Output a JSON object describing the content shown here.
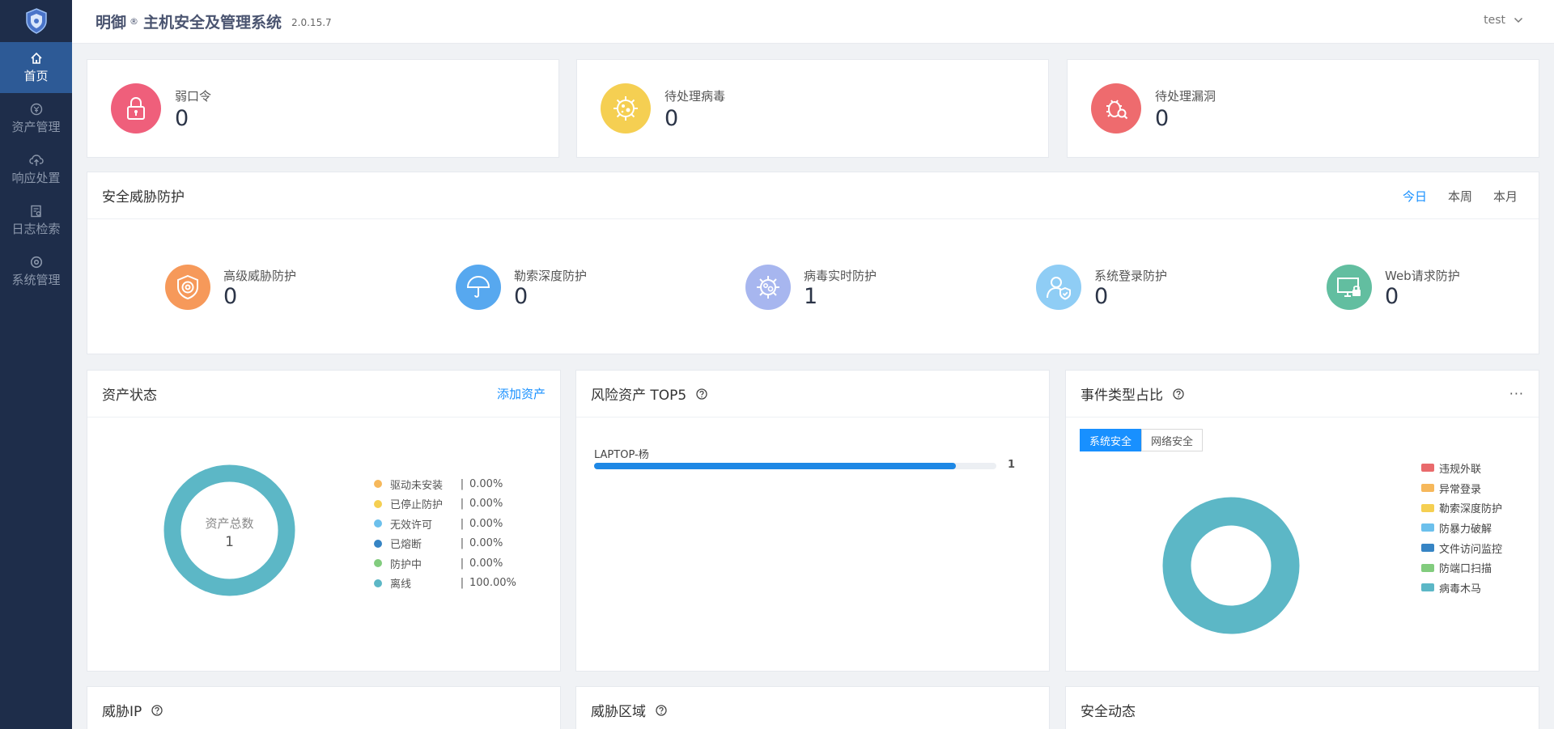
{
  "sidebar": {
    "items": [
      {
        "label": "首页",
        "icon": "home-icon",
        "active": true
      },
      {
        "label": "资产管理",
        "icon": "asset-icon"
      },
      {
        "label": "响应处置",
        "icon": "cloud-upload-icon"
      },
      {
        "label": "日志检索",
        "icon": "log-search-icon"
      },
      {
        "label": "系统管理",
        "icon": "settings-icon"
      }
    ]
  },
  "header": {
    "brand": "明御",
    "reg": "®",
    "title": "主机安全及管理系统",
    "version": "2.0.15.7",
    "user": "test"
  },
  "stats": [
    {
      "label": "弱口令",
      "value": "0",
      "icon": "lock-icon",
      "color": "#ef5f7b"
    },
    {
      "label": "待处理病毒",
      "value": "0",
      "icon": "virus-icon",
      "color": "#f5cf52"
    },
    {
      "label": "待处理漏洞",
      "value": "0",
      "icon": "bug-icon",
      "color": "#ee6b6e"
    }
  ],
  "threat_panel": {
    "title": "安全威胁防护",
    "ranges": [
      "今日",
      "本周",
      "本月"
    ],
    "active_range": "今日",
    "items": [
      {
        "label": "高级威胁防护",
        "value": "0",
        "icon": "shield-target-icon",
        "color": "#f6995a"
      },
      {
        "label": "勒索深度防护",
        "value": "0",
        "icon": "umbrella-icon",
        "color": "#57a8ef"
      },
      {
        "label": "病毒实时防护",
        "value": "1",
        "icon": "virus-scan-icon",
        "color": "#a7b6ef"
      },
      {
        "label": "系统登录防护",
        "value": "0",
        "icon": "user-shield-icon",
        "color": "#8fcdf5"
      },
      {
        "label": "Web请求防护",
        "value": "0",
        "icon": "monitor-lock-icon",
        "color": "#62bea0"
      }
    ]
  },
  "asset_panel": {
    "title": "资产状态",
    "link": "添加资产",
    "center_label": "资产总数",
    "center_value": "1",
    "legend": [
      {
        "name": "驱动未安装",
        "pct": "0.00%",
        "color": "#f6b85b"
      },
      {
        "name": "已停止防护",
        "pct": "0.00%",
        "color": "#f5cf52"
      },
      {
        "name": "无效许可",
        "pct": "0.00%",
        "color": "#6cc0ec"
      },
      {
        "name": "已熔断",
        "pct": "0.00%",
        "color": "#3684c4"
      },
      {
        "name": "防护中",
        "pct": "0.00%",
        "color": "#82cc7e"
      },
      {
        "name": "离线",
        "pct": "100.00%",
        "color": "#5cb7c6"
      }
    ]
  },
  "top5_panel": {
    "title": "风险资产 TOP5",
    "rows": [
      {
        "name": "LAPTOP-杨",
        "value": "1",
        "fraction": 0.9
      }
    ]
  },
  "event_panel": {
    "title": "事件类型占比",
    "more": "···",
    "tabs": [
      "系统安全",
      "网络安全"
    ],
    "active_tab": "系统安全",
    "legend": [
      {
        "name": "违规外联",
        "color": "#e96a6c"
      },
      {
        "name": "异常登录",
        "color": "#f6b85b"
      },
      {
        "name": "勒索深度防护",
        "color": "#f5cf52"
      },
      {
        "name": "防暴力破解",
        "color": "#6cc0ec"
      },
      {
        "name": "文件访问监控",
        "color": "#3684c4"
      },
      {
        "name": "防端口扫描",
        "color": "#82cc7e"
      },
      {
        "name": "病毒木马",
        "color": "#5cb7c6"
      }
    ]
  },
  "bottom_panels": [
    {
      "title": "威胁IP",
      "help": true
    },
    {
      "title": "威胁区域",
      "help": true
    },
    {
      "title": "安全动态",
      "help": false
    }
  ],
  "colors": {
    "sidebar": "#1e2d4a",
    "sidebar_active": "#2d5a96",
    "accent": "#1890ff",
    "donut": "#5cb7c6"
  }
}
